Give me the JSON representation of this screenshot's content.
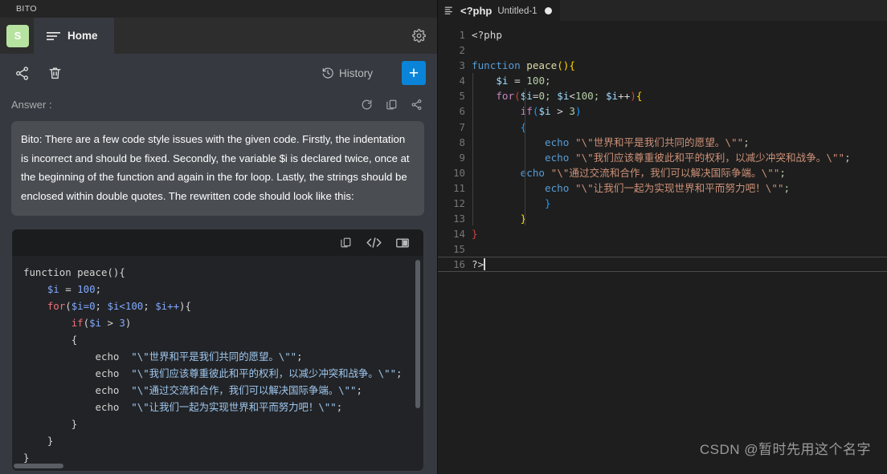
{
  "bito": {
    "window_title": "BITO",
    "avatar_initial": "S",
    "tab_label": "Home",
    "gear_icon": "gear-icon",
    "share_icon": "share-icon",
    "trash_icon": "trash-icon",
    "history_label": "History",
    "history_icon": "history-clock-icon",
    "new_chat_label": "+",
    "answer_label": "Answer :",
    "answer_toolbar": {
      "refresh_icon": "refresh-icon",
      "copy_icon": "copy-icon",
      "share_icon": "share-icon"
    },
    "answer_text": "Bito: There are a few code style issues with the given code. Firstly, the indentation is incorrect and should be fixed. Secondly, the variable $i is declared twice, once at the beginning of the function and again in the for loop. Lastly, the strings should be enclosed within double quotes. The rewritten code should look like this:",
    "code_toolbar": {
      "copy_icon": "copy-icon",
      "insert_code_icon": "code-brackets-icon",
      "diff_view_icon": "split-view-icon"
    },
    "code_lines": [
      "function peace(){",
      "    $i = 100;",
      "    for($i=0; $i<100; $i++){",
      "        if($i > 3)",
      "        {",
      "            echo \"\\\"世界和平是我们共同的愿望。\\\"\";",
      "            echo \"\\\"我们应该尊重彼此和平的权利，以减少冲突和战争。\\\"\";",
      "            echo \"\\\"通过交流和合作，我们可以解决国际争端。\\\"\";",
      "            echo \"\\\"让我们一起为实现世界和平而努力吧！\\\"\";",
      "        }",
      "    }",
      "}"
    ]
  },
  "editor": {
    "tab_language": "<?php",
    "tab_filename": "Untitled-1",
    "dirty_indicator": "unsaved-dot",
    "menu_icon": "editor-menu-icon",
    "line_numbers": [
      "1",
      "2",
      "3",
      "4",
      "5",
      "6",
      "7",
      "8",
      "9",
      "10",
      "11",
      "12",
      "13",
      "14",
      "15",
      "16"
    ],
    "lines": [
      "<?php",
      "",
      "function peace(){",
      "    $i = 100;",
      "    for($i=0; $i<100; $i++){",
      "        if($i > 3)",
      "        {",
      "            echo \"\\\"世界和平是我们共同的愿望。\\\"\";",
      "            echo \"\\\"我们应该尊重彼此和平的权利，以减少冲突和战争。\\\"\";",
      "        echo \"\\\"通过交流和合作，我们可以解决国际争端。\\\"\";",
      "            echo \"\\\"让我们一起为实现世界和平而努力吧！\\\"\";",
      "            }",
      "        }",
      "}",
      "",
      "?>"
    ],
    "cursor_line": 16,
    "watermark": "CSDN @暂时先用这个名字"
  },
  "colors": {
    "accent_blue": "#0a84d8",
    "avatar_green": "#b6e3a0",
    "panel_bg": "#36393f",
    "editor_bg": "#1e1e1e",
    "answer_card_bg": "#4a4d52"
  }
}
